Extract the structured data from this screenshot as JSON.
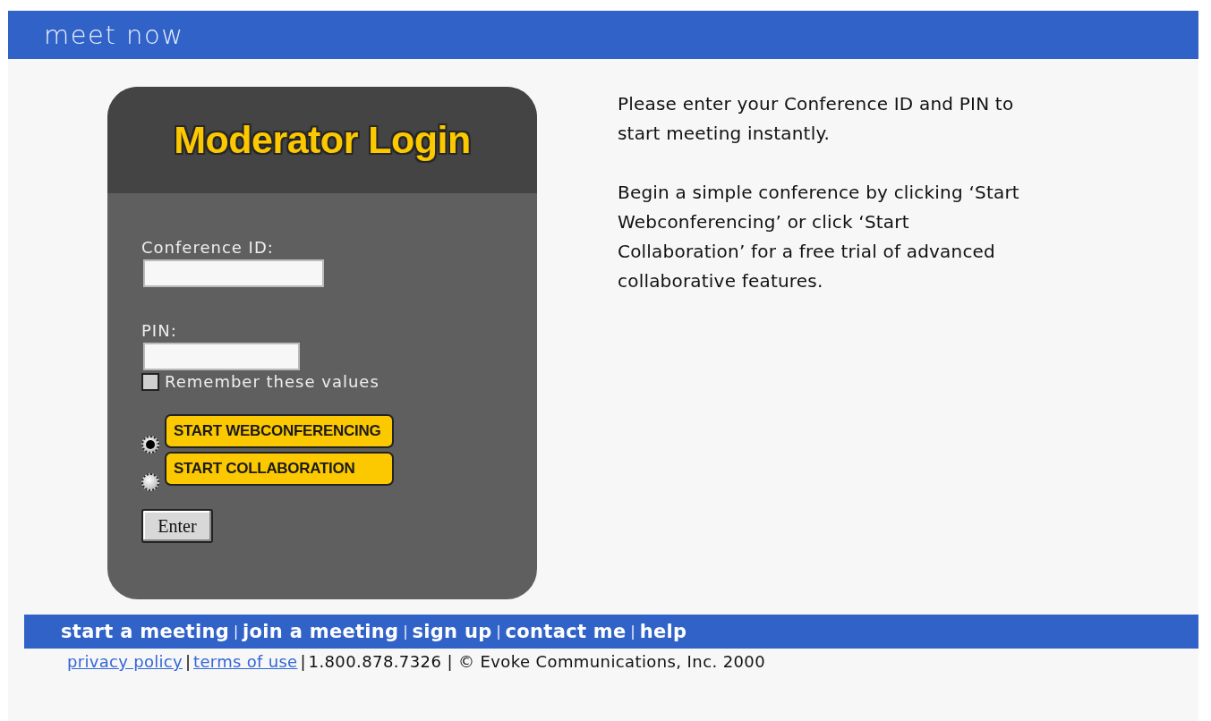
{
  "header": {
    "title": "meet now"
  },
  "login": {
    "title": "Moderator Login",
    "fields": [
      {
        "label": "Conference ID:",
        "kind": "wide"
      },
      {
        "label": "PIN:",
        "kind": "narrow"
      }
    ],
    "remember": {
      "label": "Remember these values",
      "checked": false
    },
    "options": [
      {
        "label": "START WEBCONFERENCING",
        "selected": true
      },
      {
        "label": "START COLLABORATION",
        "selected": false
      }
    ],
    "submit": "Enter"
  },
  "intro": [
    "Please enter your Conference ID and PIN to start meeting instantly.",
    "Begin a simple conference by clicking ‘Start Webconferencing’ or click ‘Start Collaboration’ for a free trial of advanced collaborative features."
  ],
  "nav": [
    {
      "kind": "link",
      "text": "start a meeting"
    },
    {
      "kind": "separator",
      "text": "|"
    },
    {
      "kind": "link",
      "text": "join a meeting"
    },
    {
      "kind": "separator",
      "text": "|"
    },
    {
      "kind": "link",
      "text": "sign up"
    },
    {
      "kind": "separator",
      "text": "|"
    },
    {
      "kind": "link",
      "text": "contact me"
    },
    {
      "kind": "separator",
      "text": "|"
    },
    {
      "kind": "link",
      "text": "help"
    }
  ],
  "footer": [
    {
      "kind": "link",
      "text": "privacy policy"
    },
    {
      "kind": "separator",
      "text": "|"
    },
    {
      "kind": "link",
      "text": "terms of use"
    },
    {
      "kind": "separator",
      "text": "|"
    },
    {
      "kind": "text",
      "text": "1.800.878.7326 | © Evoke Communications, Inc. 2000"
    }
  ]
}
